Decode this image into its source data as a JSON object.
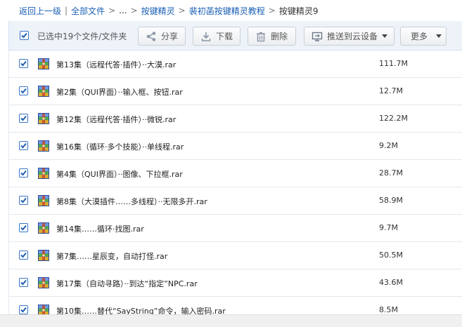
{
  "breadcrumb": {
    "back": "返回上一级",
    "all_files": "全部文件",
    "ellipsis": "...",
    "crumb1": "按键精灵",
    "crumb2": "裴初菡按键精灵教程",
    "current": "按键精灵9",
    "sep_pipe": "|",
    "sep_arrow": ">"
  },
  "toolbar": {
    "selection_text": "已选中19个文件/文件夹",
    "share": "分享",
    "download": "下载",
    "delete": "删除",
    "push": "推送到云设备",
    "more": "更多"
  },
  "files": [
    {
      "name": "第13集（远程代答·插件）··大漠.rar",
      "size": "111.7M",
      "checked": true
    },
    {
      "name": "第2集（QUI界面）··输入框、按钮.rar",
      "size": "12.7M",
      "checked": true
    },
    {
      "name": "第12集（远程代答·插件）··微锐.rar",
      "size": "122.2M",
      "checked": true
    },
    {
      "name": "第16集（循环·多个技能）··单线程.rar",
      "size": "9.2M",
      "checked": true
    },
    {
      "name": "第4集（QUI界面）··图像、下拉框.rar",
      "size": "28.7M",
      "checked": true
    },
    {
      "name": "第8集（大漠插件……多线程）··无限多开.rar",
      "size": "58.9M",
      "checked": true
    },
    {
      "name": "第14集……循环·找图.rar",
      "size": "9.7M",
      "checked": true
    },
    {
      "name": "第7集……星辰变，自动打怪.rar",
      "size": "50.5M",
      "checked": true
    },
    {
      "name": "第17集（自动寻路）··到达“指定”NPC.rar",
      "size": "43.6M",
      "checked": true
    },
    {
      "name": "第10集……替代“SayString”命令，输入密码.rar",
      "size": "8.5M",
      "checked": true
    }
  ],
  "colors": {
    "link": "#1a5fb4",
    "checkbox": "#3a76c8",
    "toolbar_bg": "#eef3fa"
  }
}
